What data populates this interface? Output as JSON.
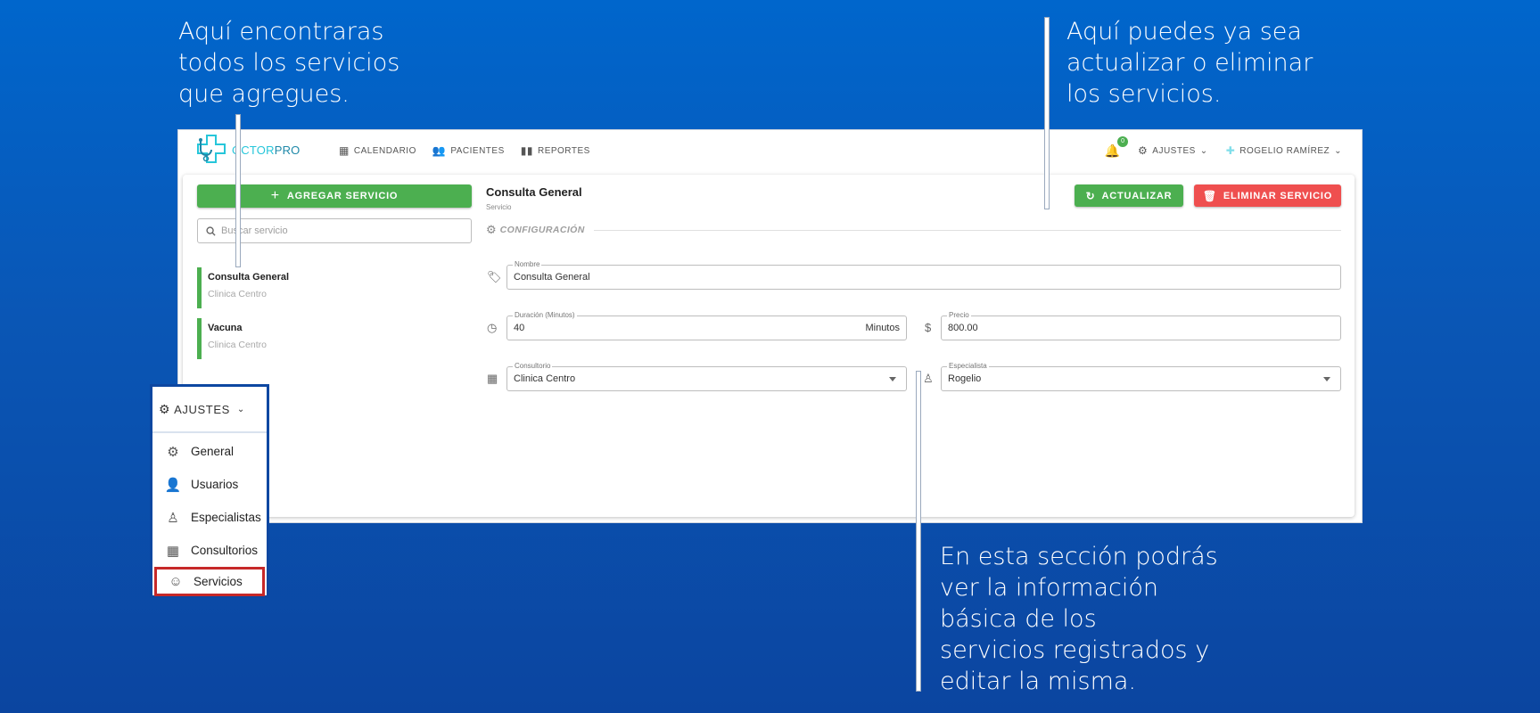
{
  "annotations": {
    "left": "Aquí encontraras\ntodos los servicios\nque agregues.",
    "right": "Aquí puedes ya sea\nactualizar o eliminar\nlos servicios.",
    "bottom": "En esta sección podrás\nver la información\nbásica de los\nservicios registrados y\neditar la misma."
  },
  "header": {
    "logo_prefix": "OCTOR",
    "logo_suffix": "PRO",
    "nav": [
      {
        "label": "CALENDARIO",
        "icon": "calendar-icon"
      },
      {
        "label": "PACIENTES",
        "icon": "people-icon"
      },
      {
        "label": "REPORTES",
        "icon": "bar-chart-icon"
      }
    ],
    "notifications_count": "0",
    "settings_label": "AJUSTES",
    "user_label": "ROGELIO RAMÍREZ"
  },
  "sidebar": {
    "add_button": "AGREGAR SERVICIO",
    "search_placeholder": "Buscar servicio",
    "services": [
      {
        "name": "Consulta General",
        "location": "Clinica Centro"
      },
      {
        "name": "Vacuna",
        "location": "Clinica Centro"
      }
    ]
  },
  "detail": {
    "title": "Consulta General",
    "subtitle": "Servicio",
    "update_button": "ACTUALIZAR",
    "delete_button": "ELIMINAR SERVICIO",
    "section_label": "CONFIGURACIÓN",
    "fields": {
      "nombre": {
        "label": "Nombre",
        "value": "Consulta General"
      },
      "duracion": {
        "label": "Duración (Minutos)",
        "value": "40",
        "suffix": "Minutos"
      },
      "precio": {
        "label": "Precio",
        "value": "800.00",
        "prefix_icon": "$"
      },
      "consultorio": {
        "label": "Consultorio",
        "value": "Clinica Centro"
      },
      "especialista": {
        "label": "Especialista",
        "value": "Rogelio"
      }
    }
  },
  "settings_menu": {
    "title": "AJUSTES",
    "items": [
      {
        "label": "General",
        "icon": "gear-icon"
      },
      {
        "label": "Usuarios",
        "icon": "person-icon"
      },
      {
        "label": "Especialistas",
        "icon": "doctor-icon"
      },
      {
        "label": "Consultorios",
        "icon": "building-icon"
      },
      {
        "label": "Servicios",
        "icon": "service-icon"
      }
    ],
    "selected": "Servicios"
  },
  "colors": {
    "primary_green": "#4caf50",
    "danger_red": "#ef4f4f",
    "brand_cyan": "#26c6da",
    "background_blue": "#0a56b5",
    "highlight_border": "#c62828",
    "menu_border": "#0d47a1"
  }
}
